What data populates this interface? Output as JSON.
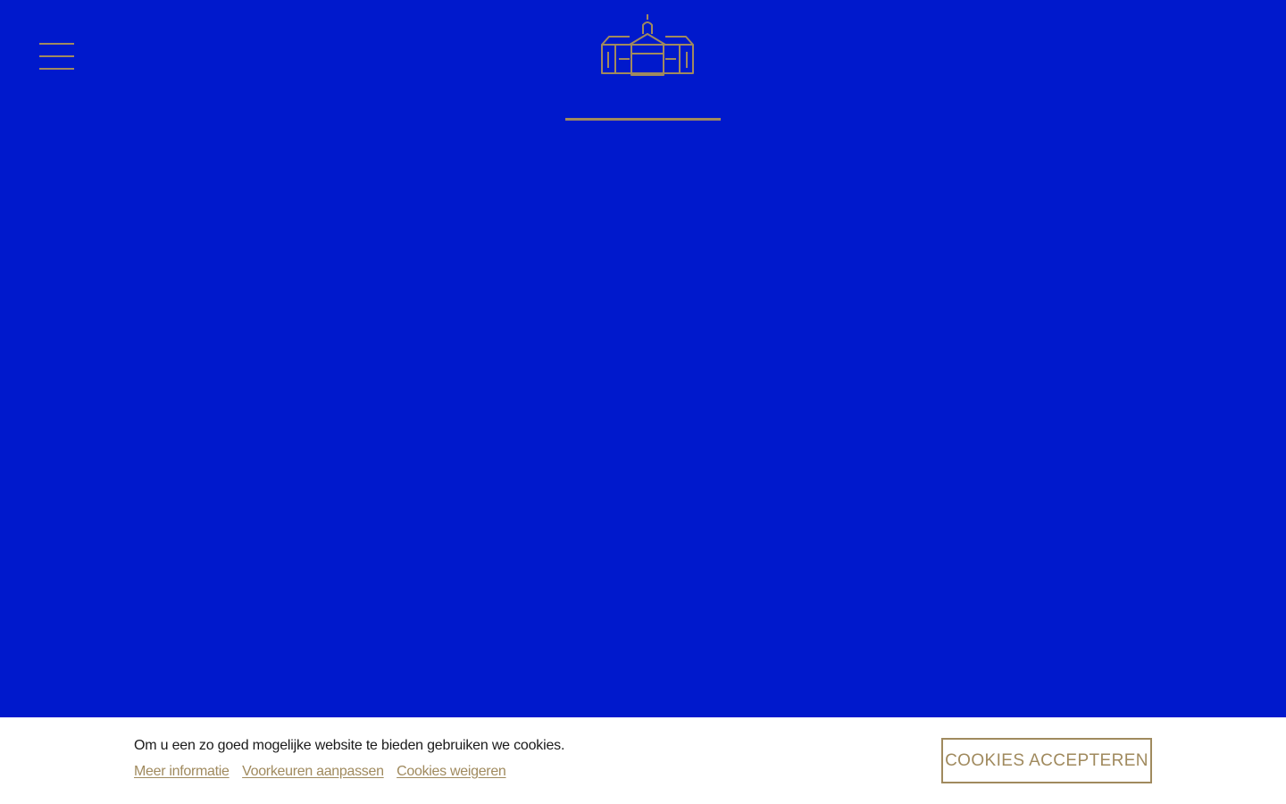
{
  "colors": {
    "background": "#0019CC",
    "accent": "#A08A5E",
    "banner_background": "#FFFFFF",
    "text": "#1A1A1A"
  },
  "header": {
    "menu_icon": "hamburger-menu-icon",
    "logo_icon": "building-facade-icon"
  },
  "cookie_banner": {
    "message": "Om u een zo goed mogelijke website te bieden gebruiken we cookies.",
    "links": {
      "more_info": "Meer informatie",
      "preferences": "Voorkeuren aanpassen",
      "decline": "Cookies weigeren"
    },
    "accept_label": "COOKIES ACCEPTEREN"
  }
}
